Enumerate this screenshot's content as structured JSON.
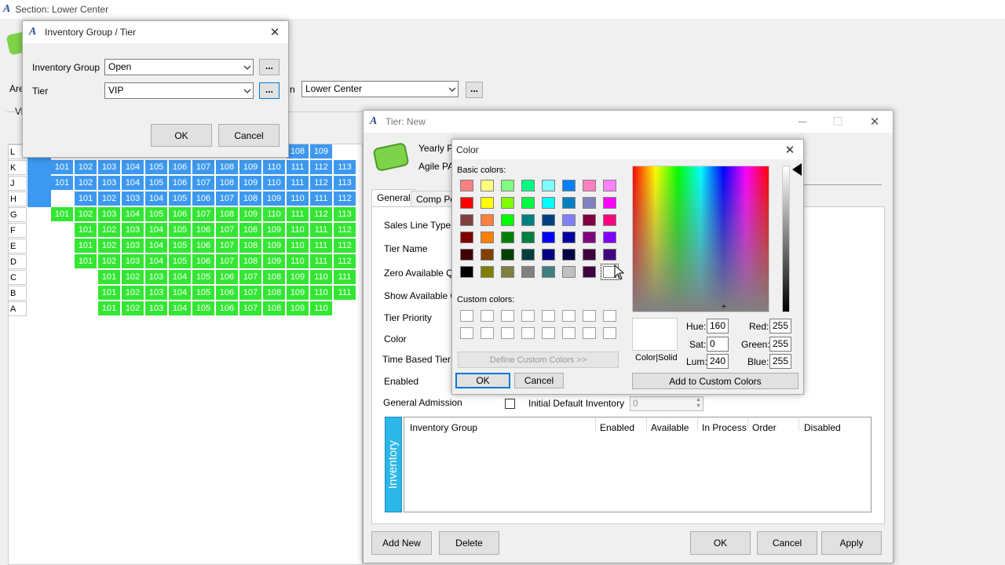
{
  "main_window": {
    "title": "Section: Lower Center",
    "area_label": "Are",
    "view_label": "Vi",
    "section_suffix": "n",
    "section_value": "Lower Center",
    "dots": "..."
  },
  "seat_map": {
    "rows": [
      {
        "label": "L",
        "start": 11,
        "seats": [
          "108",
          "109"
        ],
        "color": "#3d99f0"
      },
      {
        "label": "K",
        "start": 1,
        "seats": [
          "101",
          "102",
          "103",
          "104",
          "105",
          "106",
          "107",
          "108",
          "109",
          "110",
          "111",
          "112",
          "113"
        ],
        "color": "#3d99f0"
      },
      {
        "label": "J",
        "start": 1,
        "seats": [
          "101",
          "102",
          "103",
          "104",
          "105",
          "106",
          "107",
          "108",
          "109",
          "110",
          "111",
          "112",
          "113"
        ],
        "color": "#3d99f0"
      },
      {
        "label": "H",
        "start": 2,
        "seats": [
          "101",
          "102",
          "103",
          "104",
          "105",
          "106",
          "107",
          "108",
          "109",
          "110",
          "111",
          "112"
        ],
        "color": "#3d99f0"
      },
      {
        "label": "G",
        "start": 1,
        "seats": [
          "101",
          "102",
          "103",
          "104",
          "105",
          "106",
          "107",
          "108",
          "109",
          "110",
          "111",
          "112",
          "113"
        ],
        "color": "#33e633"
      },
      {
        "label": "F",
        "start": 2,
        "seats": [
          "101",
          "102",
          "103",
          "104",
          "105",
          "106",
          "107",
          "108",
          "109",
          "110",
          "111",
          "112"
        ],
        "color": "#33e633"
      },
      {
        "label": "E",
        "start": 2,
        "seats": [
          "101",
          "102",
          "103",
          "104",
          "105",
          "106",
          "107",
          "108",
          "109",
          "110",
          "111",
          "112"
        ],
        "color": "#33e633"
      },
      {
        "label": "D",
        "start": 2,
        "seats": [
          "101",
          "102",
          "103",
          "104",
          "105",
          "106",
          "107",
          "108",
          "109",
          "110",
          "111",
          "112"
        ],
        "color": "#33e633"
      },
      {
        "label": "C",
        "start": 3,
        "seats": [
          "101",
          "102",
          "103",
          "104",
          "105",
          "106",
          "107",
          "108",
          "109",
          "110",
          "111"
        ],
        "color": "#33e633"
      },
      {
        "label": "B",
        "start": 3,
        "seats": [
          "101",
          "102",
          "103",
          "104",
          "105",
          "106",
          "107",
          "108",
          "109",
          "110",
          "111"
        ],
        "color": "#33e633"
      },
      {
        "label": "A",
        "start": 3,
        "seats": [
          "101",
          "102",
          "103",
          "104",
          "105",
          "106",
          "107",
          "108",
          "109",
          "110"
        ],
        "color": "#33e633"
      }
    ]
  },
  "inventory_dialog": {
    "title": "Inventory Group / Tier",
    "group_label": "Inventory Group",
    "group_value": "Open",
    "tier_label": "Tier",
    "tier_value": "VIP",
    "dots": "...",
    "ok": "OK",
    "cancel": "Cancel"
  },
  "tier_dialog": {
    "title": "Tier: New",
    "header_line1": "Yearly P",
    "header_line2": "Agile PA",
    "tabs": [
      "General",
      "Comp Pol"
    ],
    "fields": [
      "Sales Line Type",
      "Tier Name",
      "Zero Available Qt",
      "Show Available Q",
      "Tier Priority",
      "Color",
      "Time Based Tier",
      "Enabled",
      "General Admission"
    ],
    "initial_default_label": "Initial Default Inventory",
    "initial_default_value": "0",
    "table_side_label": "Inventory",
    "columns": [
      "Inventory Group",
      "Enabled",
      "Available",
      "In Process",
      "Order",
      "Disabled"
    ],
    "add_new": "Add New",
    "delete": "Delete",
    "ok": "OK",
    "cancel": "Cancel",
    "apply": "Apply"
  },
  "color_dialog": {
    "title": "Color",
    "basic_label": "Basic colors:",
    "custom_label": "Custom colors:",
    "basic_colors": [
      "#ff8080",
      "#ffff80",
      "#80ff80",
      "#00ff80",
      "#80ffff",
      "#0080ff",
      "#ff80c0",
      "#ff80ff",
      "#ff0000",
      "#ffff00",
      "#80ff00",
      "#00ff40",
      "#00ffff",
      "#0080c0",
      "#8080c0",
      "#ff00ff",
      "#804040",
      "#ff8040",
      "#00ff00",
      "#008080",
      "#004080",
      "#8080ff",
      "#800040",
      "#ff0080",
      "#800000",
      "#ff8000",
      "#008000",
      "#008040",
      "#0000ff",
      "#0000a0",
      "#800080",
      "#8000ff",
      "#400000",
      "#804000",
      "#004000",
      "#004040",
      "#000080",
      "#000040",
      "#400040",
      "#400080",
      "#000000",
      "#808000",
      "#808040",
      "#808080",
      "#408080",
      "#c0c0c0",
      "#400040",
      "#ffffff"
    ],
    "define_custom": "Define Custom Colors >>",
    "ok": "OK",
    "cancel": "Cancel",
    "color_solid": "Color|Solid",
    "hue_label": "Hue:",
    "hue": "160",
    "sat_label": "Sat:",
    "sat": "0",
    "lum_label": "Lum:",
    "lum": "240",
    "red_label": "Red:",
    "red": "255",
    "green_label": "Green:",
    "green": "255",
    "blue_label": "Blue:",
    "blue": "255",
    "add_custom": "Add to Custom Colors"
  }
}
